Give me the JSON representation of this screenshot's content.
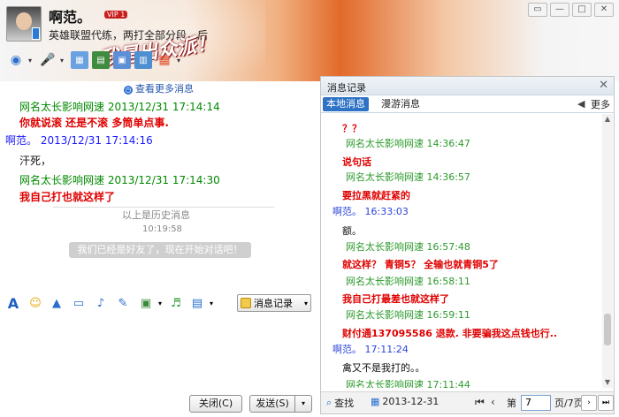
{
  "window": {
    "contact_name": "啊范。",
    "vip_label": "VIP 1",
    "signature": "英雄联盟代练，两打全部分段，后",
    "slogan": "我是出众派！",
    "buttons": {
      "restore": "▭",
      "minimize": "—",
      "maximize": "□",
      "close": "✕"
    }
  },
  "top_toolbar": {
    "icons": [
      "webcam-icon",
      "microphone-icon",
      "image-icon",
      "share-screen-icon",
      "remote-desktop-icon",
      "group-icon",
      "apps-icon"
    ]
  },
  "chat": {
    "more_messages_link": "查看更多消息",
    "messages": [
      {
        "sender": "网名太长影响网速",
        "time": "2013/12/31 17:14:14",
        "text": "你就说滚  还是不滚    多筒单点事.",
        "sender_color": "green",
        "text_style": "red"
      },
      {
        "sender": "啊范。",
        "time": "2013/12/31 17:14:16",
        "text": "汗死，",
        "sender_color": "blue",
        "text_style": "black"
      },
      {
        "sender": "网名太长影响网速",
        "time": "2013/12/31 17:14:30",
        "text": "我自己打也就这样了",
        "sender_color": "green",
        "text_style": "red"
      }
    ],
    "history_divider": "以上是历史消息",
    "history_time": "10:19:58",
    "system_message": "我们已经是好友了，现在开始对话吧！"
  },
  "input_toolbar": {
    "icons": [
      "font-icon",
      "emoji-icon",
      "shake-icon",
      "gif-icon",
      "voice-message-icon",
      "note-icon",
      "screenshot-icon",
      "music-icon",
      "video-icon"
    ],
    "history_button": "消息记录"
  },
  "actions": {
    "close_label": "关闭(C)",
    "send_label": "发送(S)"
  },
  "history_panel": {
    "title": "消息记录",
    "tabs": {
      "local": "本地消息",
      "roaming": "漫游消息"
    },
    "more_label": "更多",
    "records": [
      {
        "type": "text",
        "style": "red",
        "text": "？？"
      },
      {
        "type": "head",
        "style": "g",
        "text": "网名太长影响网速 14:36:47"
      },
      {
        "type": "text",
        "style": "red",
        "text": "说句话"
      },
      {
        "type": "head",
        "style": "g",
        "text": "网名太长影响网速 14:36:57"
      },
      {
        "type": "text",
        "style": "red",
        "text": "要拉黑就赶紧的"
      },
      {
        "type": "head",
        "style": "b",
        "text": "啊范。 16:33:03"
      },
      {
        "type": "text",
        "style": "black",
        "text": "额。"
      },
      {
        "type": "head",
        "style": "g",
        "text": "网名太长影响网速 16:57:48"
      },
      {
        "type": "text",
        "style": "red",
        "text": "就这样？  青铜5？  全输也就青铜5了"
      },
      {
        "type": "head",
        "style": "g",
        "text": "网名太长影响网速 16:58:11"
      },
      {
        "type": "text",
        "style": "red",
        "text": "我自己打最差也就这样了"
      },
      {
        "type": "head",
        "style": "g",
        "text": "网名太长影响网速 16:59:11"
      },
      {
        "type": "text",
        "style": "red",
        "text": "财付通137095586   退款.   非要骗我这点钱也行.."
      },
      {
        "type": "head",
        "style": "b",
        "text": "啊范。 17:11:24"
      },
      {
        "type": "text",
        "style": "black",
        "text": "禽又不是我打的。。"
      },
      {
        "type": "head",
        "style": "g",
        "text": "网名太长影响网速 17:11:44"
      }
    ],
    "footer": {
      "search_label": "查找",
      "date": "2013-12-31",
      "page_prefix": "第",
      "page_value": "7",
      "page_suffix": "页/7页"
    }
  }
}
